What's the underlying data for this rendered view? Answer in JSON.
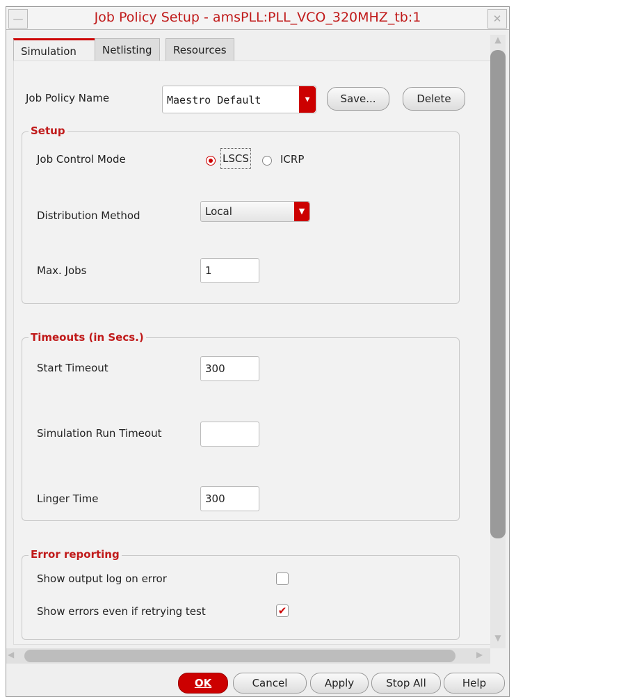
{
  "window": {
    "title": "Job Policy Setup - amsPLL:PLL_VCO_320MHZ_tb:1"
  },
  "tabs": [
    {
      "label": "Simulation",
      "active": true
    },
    {
      "label": "Netlisting"
    },
    {
      "label": "Resources"
    }
  ],
  "policy": {
    "label": "Job Policy Name",
    "value": "Maestro Default",
    "save": "Save...",
    "delete": "Delete"
  },
  "setup": {
    "title": "Setup",
    "job_control_label": "Job Control Mode",
    "modes": [
      {
        "label": "LSCS",
        "selected": true
      },
      {
        "label": "ICRP",
        "selected": false
      }
    ],
    "distribution_label": "Distribution Method",
    "distribution_value": "Local",
    "max_jobs_label": "Max. Jobs",
    "max_jobs_value": "1"
  },
  "timeouts": {
    "title": "Timeouts (in Secs.)",
    "start_label": "Start Timeout",
    "start_value": "300",
    "run_label": "Simulation Run Timeout",
    "run_value": "",
    "linger_label": "Linger Time",
    "linger_value": "300"
  },
  "errors": {
    "title": "Error reporting",
    "show_log_label": "Show output log on error",
    "show_log_checked": false,
    "show_retry_label": "Show errors even if retrying test",
    "show_retry_checked": true
  },
  "footer": {
    "ok": "OK",
    "cancel": "Cancel",
    "apply": "Apply",
    "stop_all": "Stop All",
    "help": "Help"
  },
  "icons": {
    "minimize": "—",
    "close": "✕",
    "up": "▲",
    "down": "▼",
    "left": "◀",
    "right": "▶",
    "check": "✔",
    "drop": "▼"
  }
}
